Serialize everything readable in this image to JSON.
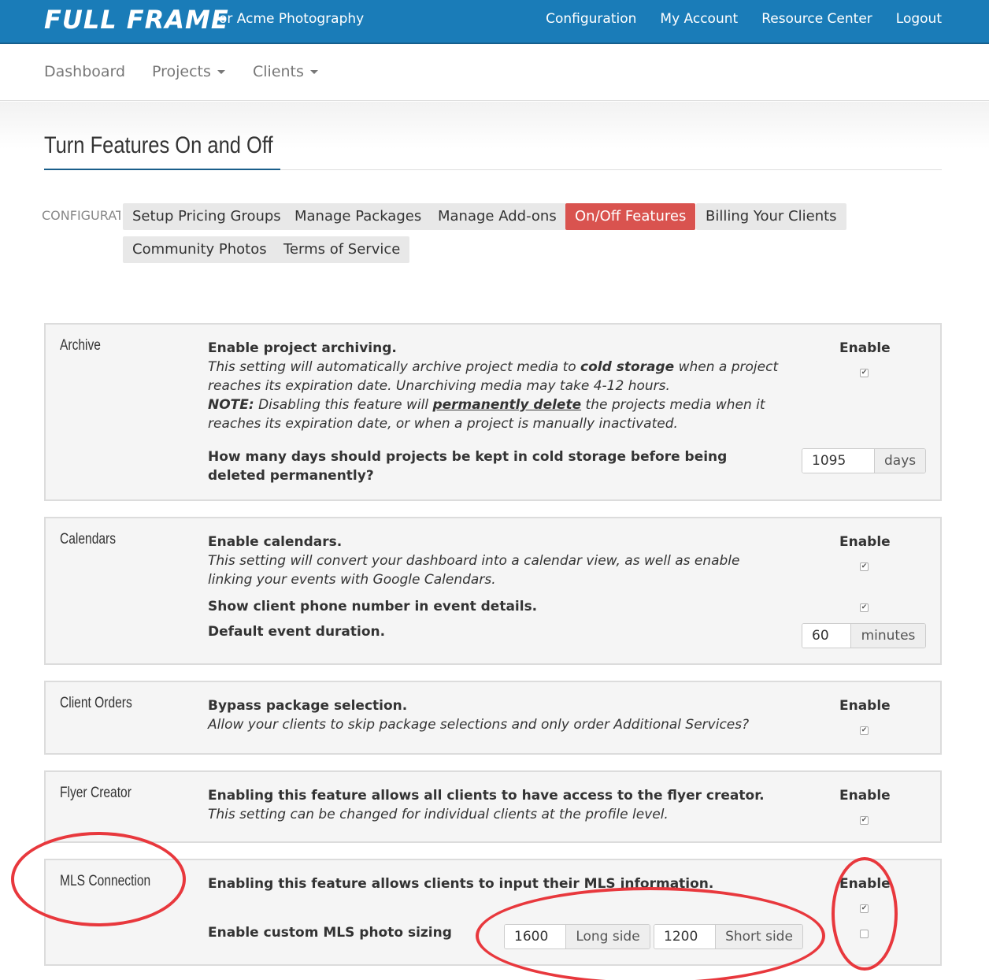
{
  "header": {
    "brand": "FULL FRAME",
    "brand_sub": "for Acme Photography",
    "nav": [
      "Configuration",
      "My Account",
      "Resource Center",
      "Logout"
    ]
  },
  "subnav": {
    "dashboard": "Dashboard",
    "projects": "Projects",
    "clients": "Clients"
  },
  "page_title": "Turn Features On and Off",
  "config": {
    "label": "CONFIGURATION",
    "tabs": [
      "Setup Pricing Groups",
      "Manage Packages",
      "Manage Add-ons",
      "On/Off Features",
      "Billing Your Clients",
      "Community Photos",
      "Terms of Service"
    ],
    "active_tab": "On/Off Features"
  },
  "enable_label": "Enable",
  "panels": {
    "archive": {
      "name": "Archive",
      "heading": "Enable project archiving.",
      "desc1": "This setting will automatically archive project media to",
      "desc1_bold": "cold storage",
      "desc1_end": "when a project reaches its expiration date. Unarchiving media may take 4-12 hours.",
      "note_label": "NOTE:",
      "note1": "Disabling this feature will",
      "note_bold": "permanently delete",
      "note2": "the projects media when it reaches its expiration date, or when a project is manually inactivated.",
      "question": "How many days should projects be kept in cold storage before being deleted permanently?",
      "days_value": "1095",
      "days_unit": "days",
      "enabled": true
    },
    "calendars": {
      "name": "Calendars",
      "heading": "Enable calendars.",
      "desc": "This setting will convert your dashboard into a calendar view, as well as enable linking your events with Google Calendars.",
      "phone_label": "Show client phone number in event details.",
      "duration_label": "Default event duration.",
      "duration_value": "60",
      "duration_unit": "minutes",
      "enabled": true,
      "phone_enabled": true
    },
    "client_orders": {
      "name": "Client Orders",
      "heading": "Bypass package selection.",
      "desc": "Allow your clients to skip package selections and only order Additional Services?",
      "enabled": true
    },
    "flyer": {
      "name": "Flyer Creator",
      "heading": "Enabling this feature allows all clients to have access to the flyer creator.",
      "desc": "This setting can be changed for individual clients at the profile level.",
      "enabled": true
    },
    "mls": {
      "name": "MLS Connection",
      "heading": "Enabling this feature allows clients to input their MLS information.",
      "sizing_label": "Enable custom MLS photo sizing",
      "long_value": "1600",
      "long_unit": "Long side",
      "short_value": "1200",
      "short_unit": "Short side",
      "enabled": true,
      "sizing_enabled": false
    }
  },
  "colors": {
    "header": "#1a7cb8",
    "active_tab": "#d9534f",
    "annotation": "#e8383d"
  }
}
